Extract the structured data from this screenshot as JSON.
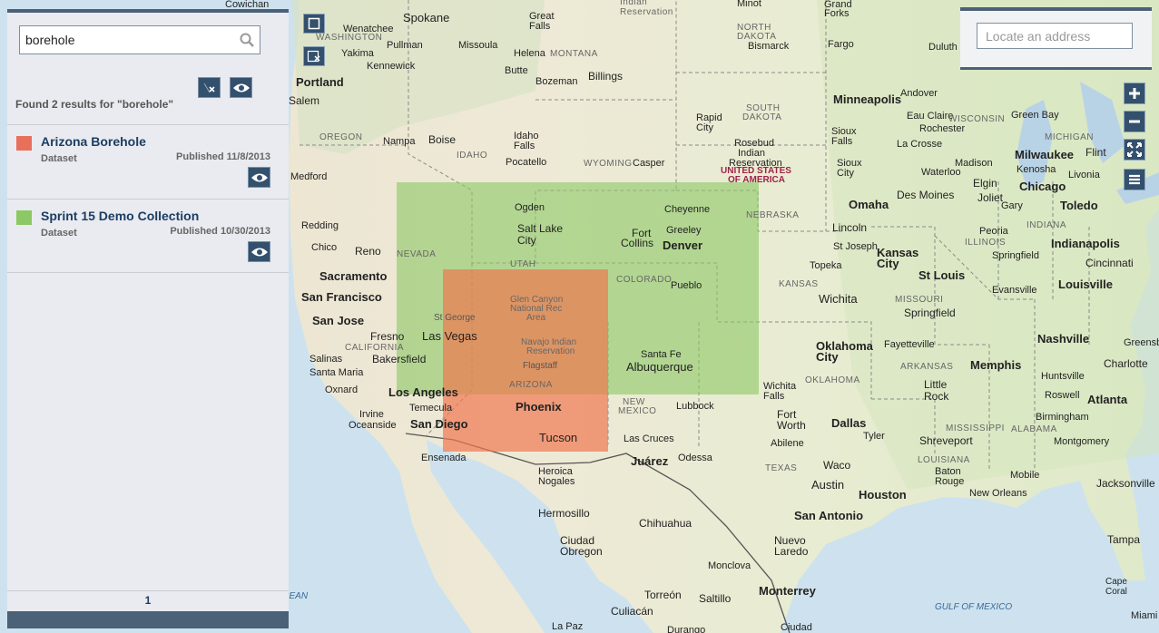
{
  "search": {
    "value": "borehole",
    "results_text": "Found 2 results for \"borehole\""
  },
  "results": [
    {
      "title": "Arizona Borehole",
      "type": "Dataset",
      "published": "Published 11/8/2013",
      "color": "#e8705a"
    },
    {
      "title": "Sprint 15 Demo Collection",
      "type": "Dataset",
      "published": "Published 10/30/2013",
      "color": "#8cc864"
    }
  ],
  "pager": {
    "current_page": "1"
  },
  "locator": {
    "placeholder": "Locate an address"
  },
  "map": {
    "footprint_colors": {
      "sprint_collection": "#8cc864",
      "arizona_borehole": "#f07850"
    },
    "states": [
      "WASHINGTON",
      "OREGON",
      "IDAHO",
      "MONTANA",
      "NORTH DAKOTA",
      "SOUTH DAKOTA",
      "WYOMING",
      "NEVADA",
      "UTAH",
      "COLORADO",
      "NEBRASKA",
      "KANSAS",
      "CALIFORNIA",
      "ARIZONA",
      "NEW MEXICO",
      "OKLAHOMA",
      "TEXAS",
      "MISSOURI",
      "ARKANSAS",
      "LOUISIANA",
      "MISSISSIPPI",
      "ALABAMA",
      "ILLINOIS",
      "INDIANA",
      "MICHIGAN",
      "WISCONSIN"
    ],
    "countries": [
      "UNITED STATES OF AMERICA"
    ],
    "water": [
      "GULF OF MEXICO",
      "PACIFIC OCEAN"
    ],
    "cities": [
      "Spokane",
      "Great Falls",
      "Minot",
      "Grand Forks",
      "Duluth",
      "Yakima",
      "Wenatchee",
      "Pullman",
      "Helena",
      "Missoula",
      "Bismarck",
      "Fargo",
      "Portland",
      "Salem",
      "Kennewick",
      "Butte",
      "Bozeman",
      "Billings",
      "Minneapolis",
      "Andover",
      "Green Bay",
      "Boise",
      "Nampa",
      "Idaho Falls",
      "Pocatello",
      "Rapid City",
      "Sioux Falls",
      "Rochester",
      "Eau Claire",
      "La Crosse",
      "Medford",
      "Casper",
      "Rosebud Indian Reservation",
      "Sioux City",
      "Waterloo",
      "Milwaukee",
      "Kenosha",
      "Flint",
      "Livonia",
      "Madison",
      "Chicago",
      "Joliet",
      "Elgin",
      "Des Moines",
      "Omaha",
      "Lincoln",
      "Ogden",
      "Salt Lake City",
      "Cheyenne",
      "Greeley",
      "Fort Collins",
      "Denver",
      "Reno",
      "Redding",
      "Chico",
      "Sacramento",
      "San Francisco",
      "San Jose",
      "Fresno",
      "Salinas",
      "Santa Maria",
      "Bakersfield",
      "Oxnard",
      "Los Angeles",
      "Irvine",
      "Oceanside",
      "San Diego",
      "Temecula",
      "Ensenada",
      "Las Vegas",
      "St George",
      "Flagstaff",
      "Phoenix",
      "Tucson",
      "Heroica Nogales",
      "Pueblo",
      "Santa Fe",
      "Albuquerque",
      "Lubbock",
      "Las Cruces",
      "Juárez",
      "Odessa",
      "Hermosillo",
      "Chihuahua",
      "Ciudad Obregon",
      "Torreón",
      "Saltillo",
      "Monterrey",
      "Monclova",
      "Nuevo Laredo",
      "Culiacán",
      "La Paz",
      "Durango",
      "Ciudad",
      "Topeka",
      "Kansas City",
      "St Joseph",
      "Wichita",
      "Oklahoma City",
      "Wichita Falls",
      "Fort Worth",
      "Dallas",
      "Abilene",
      "Waco",
      "Austin",
      "Houston",
      "San Antonio",
      "Tyler",
      "Shreveport",
      "Baton Rouge",
      "New Orleans",
      "Mobile",
      "Little Rock",
      "Fayetteville",
      "Springfield",
      "St Louis",
      "Peoria",
      "Indianapolis",
      "Evansville",
      "Louisville",
      "Memphis",
      "Nashville",
      "Huntsville",
      "Birmingham",
      "Atlanta",
      "Roswell",
      "Montgomery",
      "Jacksonville",
      "Tampa",
      "Charlotte",
      "Greensboro",
      "Cincinnati",
      "Toledo",
      "Gary",
      "Glen Canyon National Rec Area",
      "Navajo Indian Reservation",
      "Cape Coral",
      "Miami",
      "Cowichan"
    ]
  }
}
